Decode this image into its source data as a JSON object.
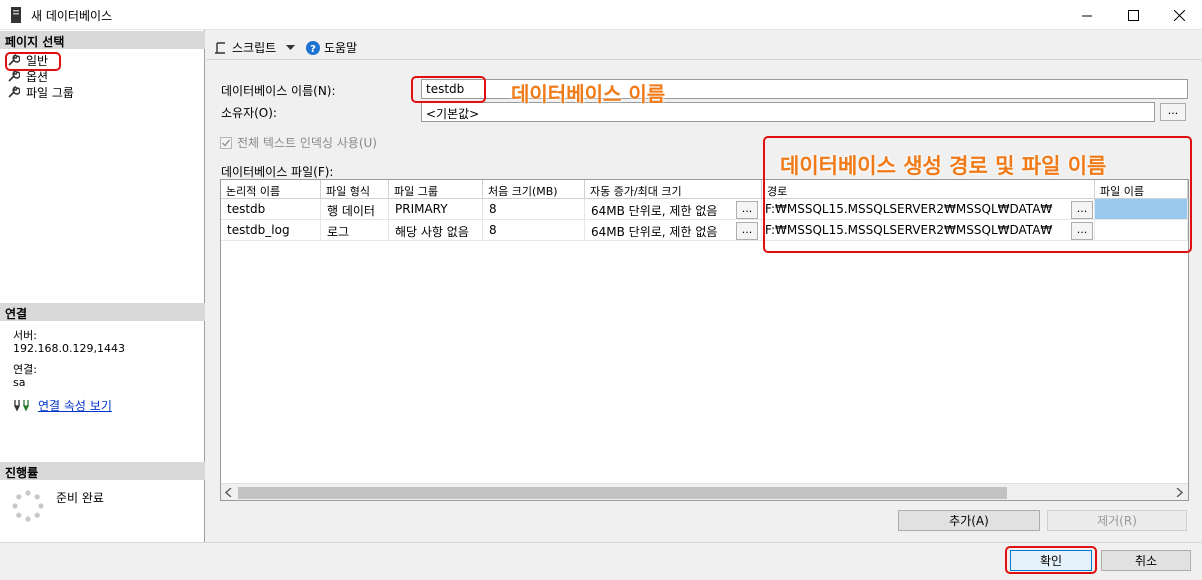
{
  "window": {
    "title": "새 데이터베이스"
  },
  "left_pane": {
    "page_select_header": "페이지 선택",
    "nav_items": [
      {
        "label": "일반",
        "icon": "wrench-icon"
      },
      {
        "label": "옵션",
        "icon": "wrench-icon"
      },
      {
        "label": "파일 그룹",
        "icon": "wrench-icon"
      }
    ],
    "connection_header": "연결",
    "server_label": "서버:",
    "server_value": "192.168.0.129,1443",
    "connection_label": "연결:",
    "connection_value": "sa",
    "view_props_link": "연결 속성 보기",
    "progress_header": "진행률",
    "progress_status": "준비 완료"
  },
  "toolbar": {
    "script_label": "스크립트",
    "help_label": "도움말"
  },
  "form": {
    "db_name_label": "데이터베이스 이름(N):",
    "db_name_value": "testdb",
    "owner_label": "소유자(O):",
    "owner_value": "<기본값>",
    "fulltext_label": "전체 텍스트 인덱싱 사용(U)",
    "files_label": "데이터베이스 파일(F):"
  },
  "grid": {
    "columns": [
      "논리적 이름",
      "파일 형식",
      "파일 그룹",
      "처음 크기(MB)",
      "자동 증가/최대 크기",
      "경로",
      "파일 이름"
    ],
    "rows": [
      {
        "logical_name": "testdb",
        "file_type": "행 데이터",
        "filegroup": "PRIMARY",
        "initial_size": "8",
        "autogrowth": "64MB 단위로, 제한 없음",
        "path": "F:₩MSSQL15.MSSQLSERVER2₩MSSQL₩DATA₩",
        "file_name": ""
      },
      {
        "logical_name": "testdb_log",
        "file_type": "로그",
        "filegroup": "해당 사항 없음",
        "initial_size": "8",
        "autogrowth": "64MB 단위로, 제한 없음",
        "path": "F:₩MSSQL15.MSSQLSERVER2₩MSSQL₩DATA₩",
        "file_name": ""
      }
    ],
    "ellipsis": "..."
  },
  "buttons": {
    "add": "추가(A)",
    "remove": "제거(R)",
    "ok": "확인",
    "cancel": "취소"
  },
  "annotations": {
    "db_name_note": "데이터베이스 이름",
    "path_note": "데이터베이스 생성 경로 및 파일 이름"
  },
  "colors": {
    "annotation_red": "#e01010",
    "annotation_orange": "#f07a17",
    "selection": "#99c9ef",
    "link": "#0033cc"
  }
}
